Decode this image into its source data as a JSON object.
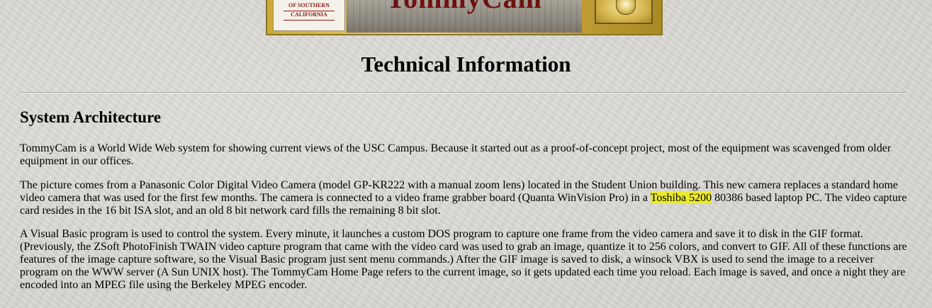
{
  "banner": {
    "university_line1": "OF SOUTHERN",
    "university_line2": "CALIFORNIA",
    "title": "TommyCam",
    "seal_icon": "usc-seal-icon",
    "colors": {
      "gold": "#d9bd55",
      "cardinal": "#6e1111"
    }
  },
  "page": {
    "title": "Technical Information"
  },
  "section": {
    "title": "System Architecture",
    "p1": "TommyCam is a World Wide Web system for showing current views of the USC Campus. Because it started out as a proof-of-concept project, most of the equipment was scavenged from older equipment in our offices.",
    "p2_before": "The picture comes from a Panasonic Color Digital Video Camera (model GP-KR222 with a manual zoom lens) located in the Student Union building. This new camera replaces a standard home video camera that was used for the first few months. The camera is connected to a video frame grabber board (Quanta WinVision Pro) in a ",
    "p2_highlight": "Toshiba 5200",
    "p2_after": " 80386 based laptop PC. The video capture card resides in the 16 bit ISA slot, and an old 8 bit network card fills the remaining 8 bit slot.",
    "p3": "A Visual Basic program is used to control the system. Every minute, it launches a custom DOS program to capture one frame from the video camera and save it to disk in the GIF format. (Previously, the ZSoft PhotoFinish TWAIN video capture program that came with the video card was used to grab an image, quantize it to 256 colors, and convert to GIF. All of these functions are features of the image capture software, so the Visual Basic program just sent menu commands.) After the GIF image is saved to disk, a winsock VBX is used to send the image to a receiver program on the WWW server (A Sun UNIX host). The TommyCam Home Page refers to the current image, so it gets updated each time you reload. Each image is saved, and once a night they are encoded into an MPEG file using the Berkeley MPEG encoder."
  },
  "highlight_color": "#eaea2a"
}
